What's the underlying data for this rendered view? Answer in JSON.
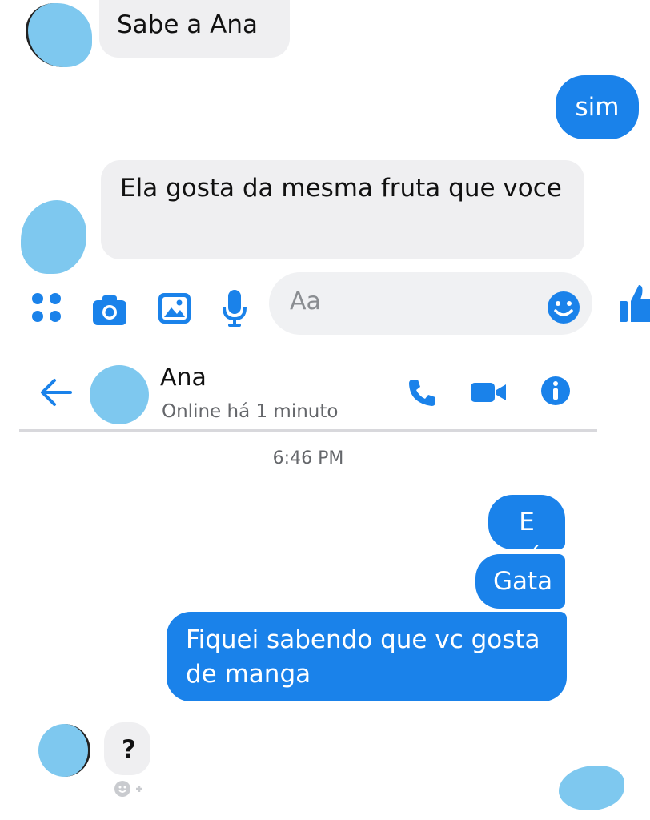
{
  "messages_top": [
    {
      "text": "Sabe a Ana",
      "from": "them"
    },
    {
      "text": "sim",
      "from": "me"
    },
    {
      "text": "Ela gosta da mesma fruta que voce",
      "from": "them"
    }
  ],
  "composer": {
    "placeholder": "Aa",
    "icons": [
      "more-dots-icon",
      "camera-icon",
      "image-icon",
      "microphone-icon",
      "emoji-icon",
      "like-thumb-icon"
    ]
  },
  "header": {
    "contact_name": "Ana",
    "status": "Online há 1 minuto",
    "icons": [
      "back-arrow-icon",
      "phone-icon",
      "video-camera-icon",
      "info-icon"
    ]
  },
  "timestamp": "6:46 PM",
  "messages_bottom": [
    {
      "text": "E aí",
      "from": "me"
    },
    {
      "text": "Gata",
      "from": "me"
    },
    {
      "text": "Fiquei sabendo que vc gosta de manga",
      "from": "me"
    },
    {
      "text": "?",
      "from": "them"
    }
  ],
  "colors": {
    "accent": "#1a82ea",
    "incoming_bubble": "#efeff1",
    "avatar_scribble": "#7ec8ef"
  }
}
